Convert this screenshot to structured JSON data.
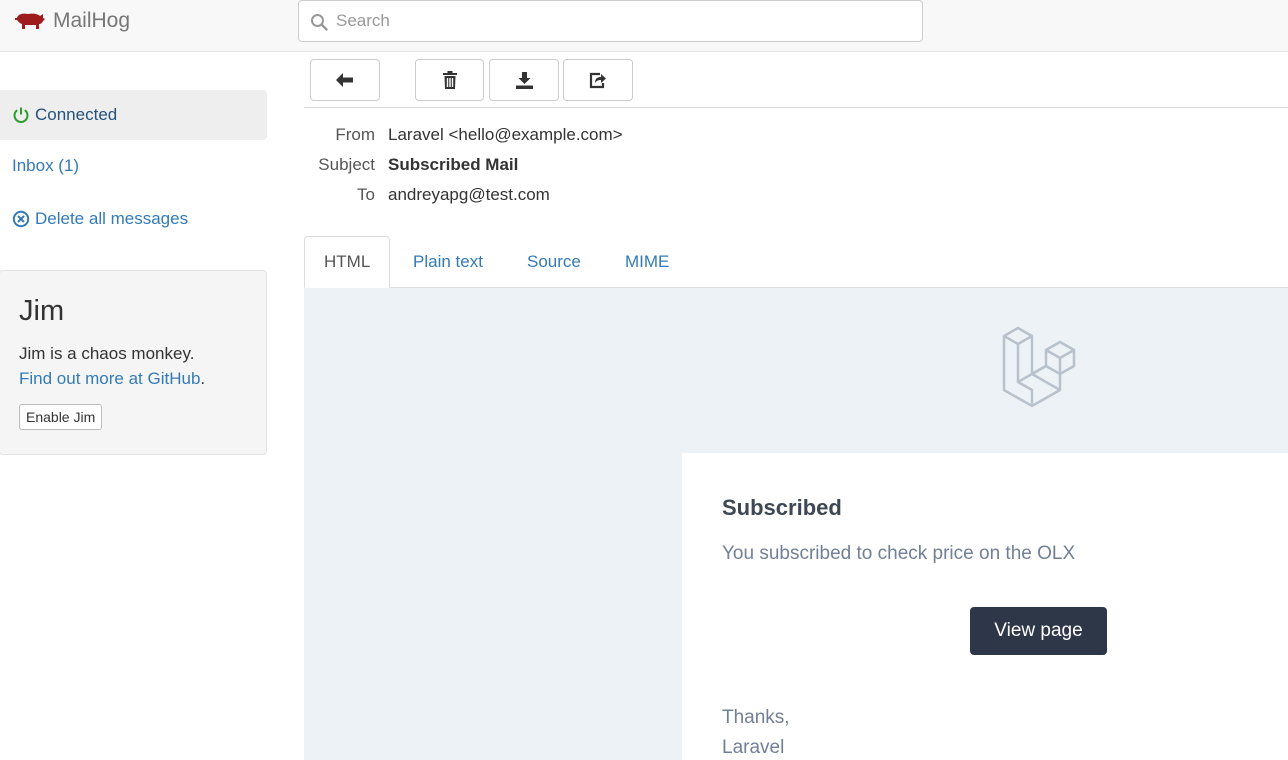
{
  "brand": {
    "name": "MailHog",
    "icon": "pig-icon",
    "color": "#9e1c1c"
  },
  "search": {
    "placeholder": "Search",
    "value": ""
  },
  "sidebar": {
    "connected_label": "Connected",
    "inbox_label": "Inbox (1)",
    "delete_all_label": "Delete all messages",
    "status_color": "#2a9d2a"
  },
  "jim": {
    "title": "Jim",
    "description": "Jim is a chaos monkey.",
    "link_text": "Find out more at GitHub",
    "link_suffix": ".",
    "button_label": "Enable Jim"
  },
  "toolbar": {
    "back_icon": "arrow-left-icon",
    "delete_icon": "trash-icon",
    "download_icon": "download-icon",
    "release_icon": "share-icon"
  },
  "message": {
    "headers": {
      "from_label": "From",
      "from_value": "Laravel <hello@example.com>",
      "subject_label": "Subject",
      "subject_value": "Subscribed Mail",
      "to_label": "To",
      "to_value": "andreyapg@test.com"
    },
    "tabs": [
      {
        "label": "HTML",
        "active": true
      },
      {
        "label": "Plain text",
        "active": false
      },
      {
        "label": "Source",
        "active": false
      },
      {
        "label": "MIME",
        "active": false
      }
    ]
  },
  "email": {
    "logo": "laravel-logo-icon",
    "heading": "Subscribed",
    "body": "You subscribed to check price on the OLX",
    "button_label": "View page",
    "thanks": "Thanks,",
    "signature": "Laravel",
    "colors": {
      "background": "#edf2f7",
      "button": "#2d3748",
      "text": "#718096"
    }
  }
}
